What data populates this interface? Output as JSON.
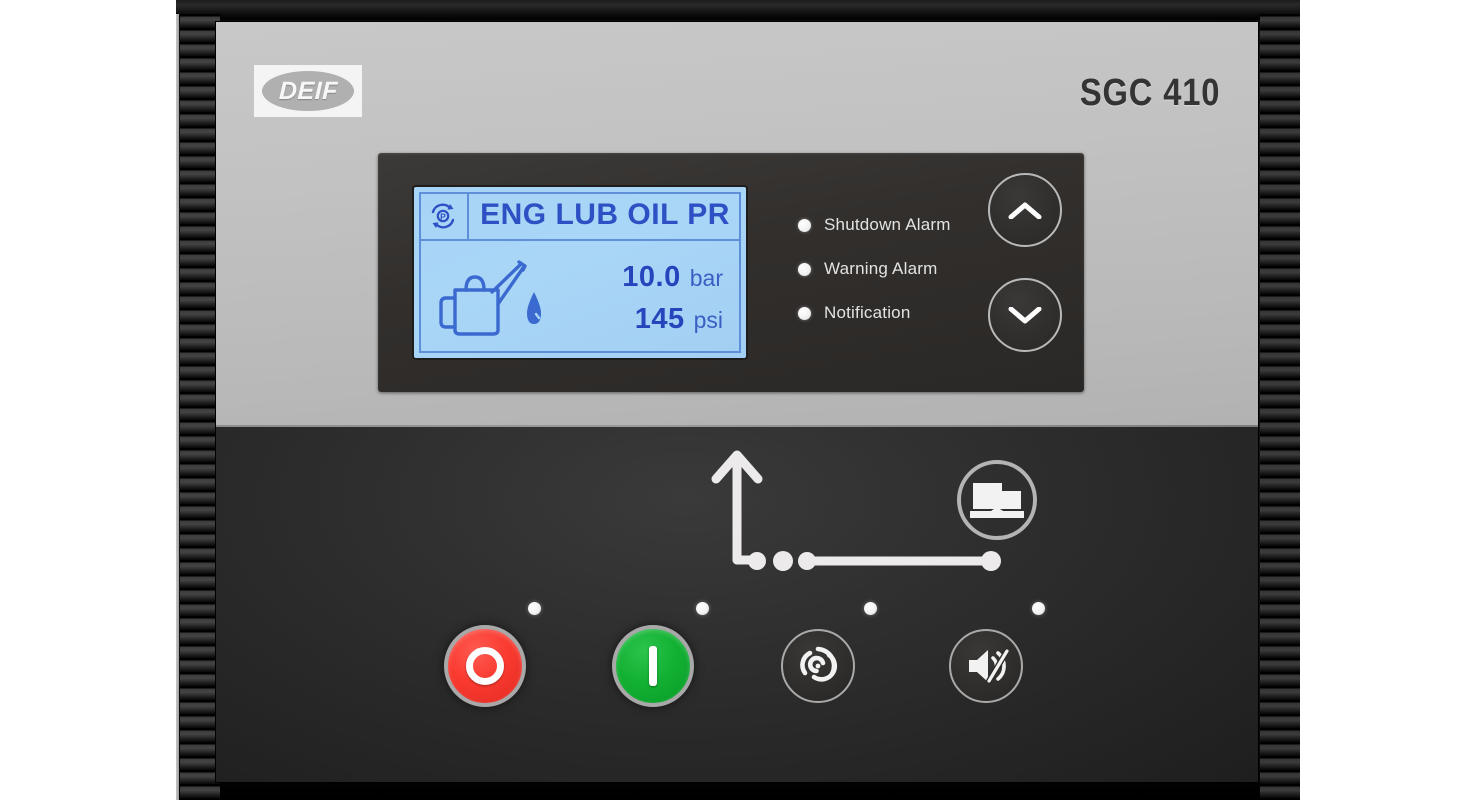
{
  "device": {
    "brand": "DEIF",
    "model": "SGC 410"
  },
  "display": {
    "header_icon": "cycle-pressure-icon",
    "title": "ENG LUB OIL PR",
    "graphic_icon": "oil-can-drop-icon",
    "readouts": [
      {
        "value": "10.0",
        "unit": "bar"
      },
      {
        "value": "145",
        "unit": "psi"
      }
    ]
  },
  "alarms": [
    {
      "label": "Shutdown Alarm",
      "led": "off"
    },
    {
      "label": "Warning Alarm",
      "led": "off"
    },
    {
      "label": "Notification",
      "led": "off"
    }
  ],
  "navigation": [
    {
      "name": "scroll-up-button",
      "icon": "chevron-up-icon"
    },
    {
      "name": "scroll-down-button",
      "icon": "chevron-down-icon"
    }
  ],
  "mimic": {
    "load_icon": "load-arrow-up-icon",
    "genset_icon": "genset-engine-icon",
    "breaker_open_dots": 2,
    "busbar_dots": 2
  },
  "control_buttons": [
    {
      "name": "stop-button",
      "icon": "power-off-ring-icon",
      "color": "#f93a30",
      "led": "off"
    },
    {
      "name": "start-button",
      "icon": "power-on-bar-icon",
      "color": "#13b133",
      "led": "off"
    },
    {
      "name": "auto-mode-button",
      "icon": "auto-spiral-icon",
      "color": "#302e2c",
      "led": "off"
    },
    {
      "name": "alarm-mute-button",
      "icon": "horn-mute-icon",
      "color": "#302e2c",
      "led": "off"
    }
  ],
  "colors": {
    "plate_upper": "#c2c2c2",
    "plate_lower": "#2e2e2e",
    "lcd_background": "#a9d6f7",
    "lcd_ink": "#2645bd",
    "stop_red": "#f93a30",
    "start_green": "#13b133",
    "led_white": "#ffffff"
  }
}
